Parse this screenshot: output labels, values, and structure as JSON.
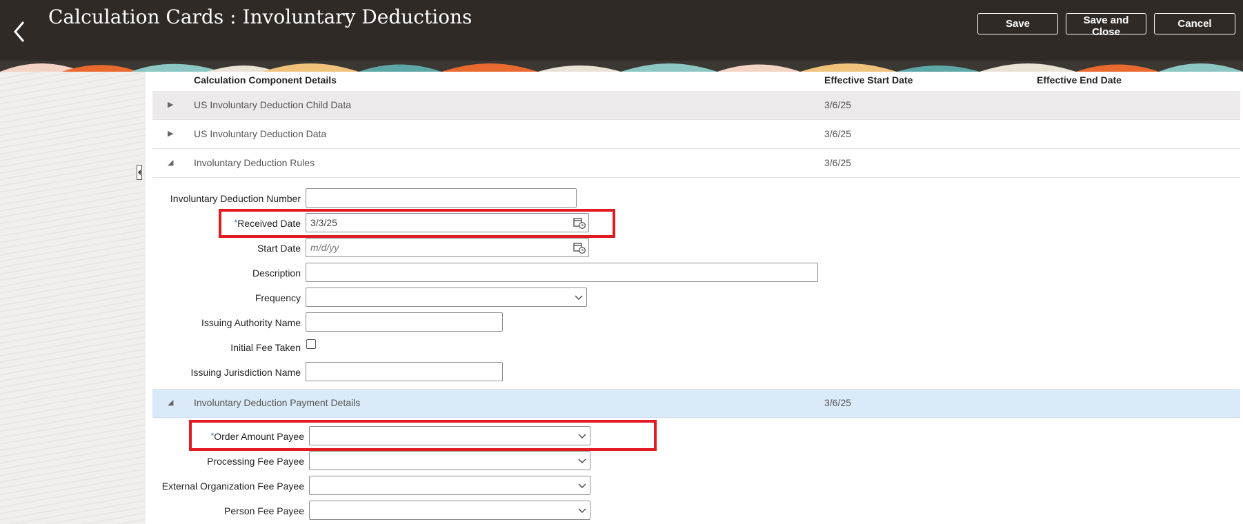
{
  "header": {
    "back_label": "",
    "title": "Calculation Cards : Involuntary Deductions",
    "buttons": {
      "save": "Save",
      "save_close": "Save and Close",
      "cancel": "Cancel"
    }
  },
  "table": {
    "columns": {
      "component": "Calculation Component Details",
      "start": "Effective Start Date",
      "end": "Effective End Date"
    },
    "rows": [
      {
        "name": "US Involuntary Deduction Child Data",
        "start": "3/6/25",
        "expanded": false
      },
      {
        "name": "US Involuntary Deduction Data",
        "start": "3/6/25",
        "expanded": false
      },
      {
        "name": "Involuntary Deduction Rules",
        "start": "3/6/25",
        "expanded": true
      },
      {
        "name": "Involuntary Deduction Payment Details",
        "start": "3/6/25",
        "expanded": true
      }
    ]
  },
  "rules_form": {
    "deduction_number": {
      "label": "Involuntary Deduction Number",
      "value": ""
    },
    "received_date": {
      "label": "Received Date",
      "required": "*",
      "value": "3/3/25"
    },
    "start_date": {
      "label": "Start Date",
      "placeholder": "m/d/yy"
    },
    "description": {
      "label": "Description",
      "value": ""
    },
    "frequency": {
      "label": "Frequency",
      "value": ""
    },
    "issuing_authority": {
      "label": "Issuing Authority Name",
      "value": ""
    },
    "initial_fee": {
      "label": "Initial Fee Taken",
      "checked": false
    },
    "issuing_jurisdiction": {
      "label": "Issuing Jurisdiction Name",
      "value": ""
    }
  },
  "payment_form": {
    "order_amount_payee": {
      "label": "Order Amount Payee",
      "required": "*",
      "value": ""
    },
    "processing_fee_payee": {
      "label": "Processing Fee Payee",
      "value": ""
    },
    "external_org_fee_payee": {
      "label": "External Organization Fee Payee",
      "value": ""
    },
    "person_fee_payee": {
      "label": "Person Fee Payee",
      "value": ""
    }
  },
  "colors": {
    "header_bg": "#302a26",
    "highlight": "#e11b22",
    "selected_row": "#dbeaf8",
    "required_star": "#2a6db5"
  },
  "icons": [
    "chevron-left-icon",
    "calendar-icon",
    "chevron-down-icon",
    "triangle-right-icon",
    "triangle-down-icon"
  ]
}
